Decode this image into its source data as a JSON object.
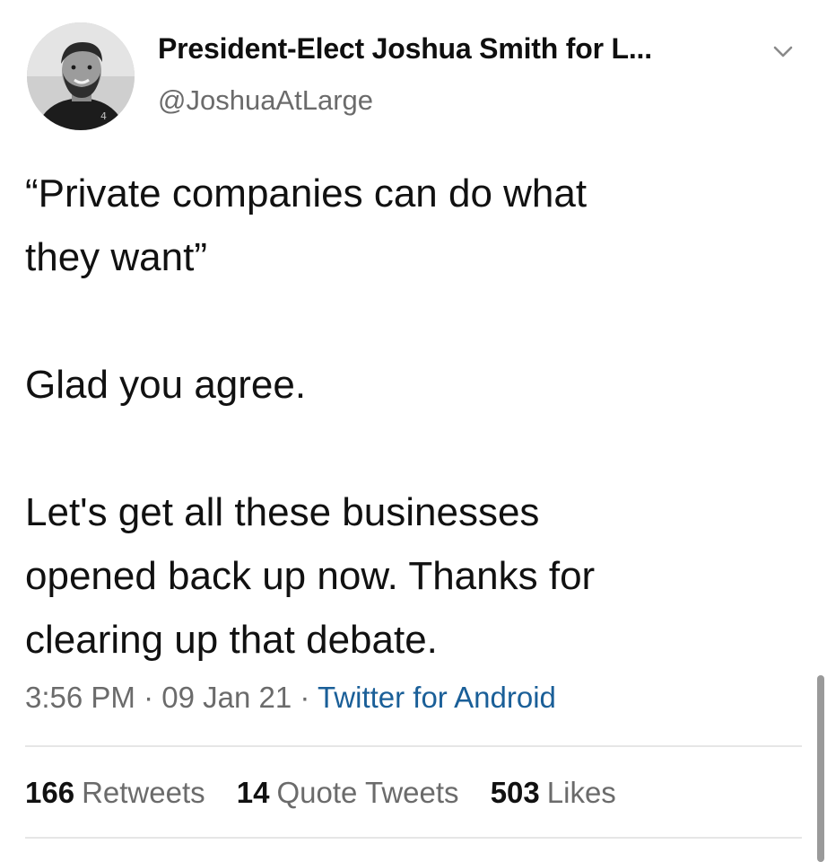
{
  "author": {
    "display_name": "President-Elect Joshua Smith for L...",
    "handle": "@JoshuaAtLarge",
    "avatar_icon": "profile-photo"
  },
  "tweet": {
    "lines": [
      "“Private companies can do what",
      "they want”",
      "Glad you agree.",
      "Let's get all these businesses",
      "opened back up now. Thanks for",
      "clearing up that debate."
    ]
  },
  "meta": {
    "time": "3:56 PM",
    "separator": " · ",
    "date": "09 Jan 21",
    "source": "Twitter for Android"
  },
  "stats": {
    "retweets_count": "166",
    "retweets_label": "Retweets",
    "quotes_count": "14",
    "quotes_label": "Quote Tweets",
    "likes_count": "503",
    "likes_label": "Likes"
  },
  "colors": {
    "link": "#1a5f98",
    "secondary_text": "#6b6b6b",
    "primary_text": "#111111"
  },
  "icons": {
    "menu": "chevron-down-icon"
  }
}
